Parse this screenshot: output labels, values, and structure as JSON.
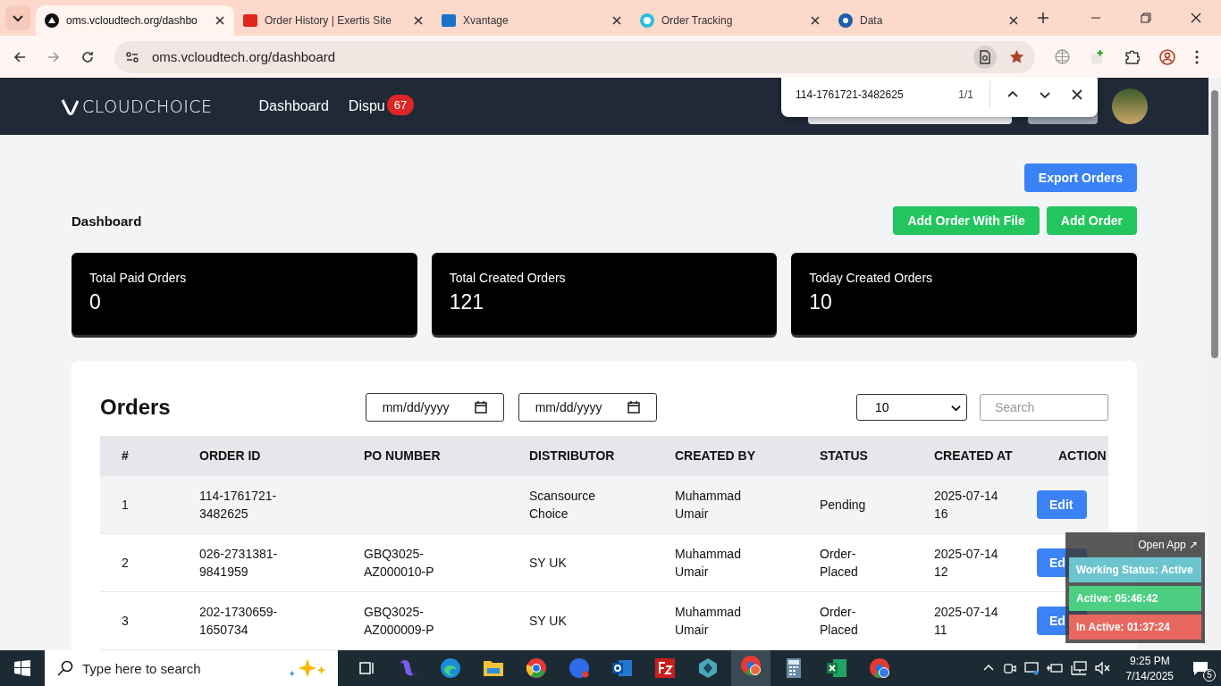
{
  "browser": {
    "tabs": [
      {
        "title": "oms.vcloudtech.org/dashbo",
        "selected": true
      },
      {
        "title": "Order History | Exertis Site",
        "selected": false
      },
      {
        "title": "Xvantage",
        "selected": false
      },
      {
        "title": "Order Tracking",
        "selected": false
      },
      {
        "title": "Data",
        "selected": false
      }
    ],
    "address": "oms.vcloudtech.org/dashboard",
    "find_bar": {
      "query": "114-1761721-3482625",
      "count": "1/1"
    }
  },
  "app": {
    "logo": "CLOUDCHOICE",
    "nav": [
      {
        "label": "Dashboard"
      },
      {
        "label": "Dispu",
        "badge": "67"
      }
    ]
  },
  "toolbar": {
    "export": "Export Orders",
    "heading": "Dashboard",
    "actions": [
      "Add Order With File",
      "Add Order"
    ]
  },
  "stats": [
    {
      "label": "Total Paid Orders",
      "value": "0"
    },
    {
      "label": "Total Created Orders",
      "value": "121"
    },
    {
      "label": "Today Created Orders",
      "value": "10"
    }
  ],
  "orders": {
    "title": "Orders",
    "date_from": {
      "placeholder": "mm/dd/yyyy"
    },
    "date_to": {
      "placeholder": "mm/dd/yyyy"
    },
    "page_size": "10",
    "search": {
      "placeholder": "Search"
    },
    "columns": [
      "#",
      "ORDER ID",
      "PO NUMBER",
      "DISTRIBUTOR",
      "CREATED BY",
      "STATUS",
      "CREATED AT",
      "ACTION"
    ],
    "rows": [
      {
        "n": "1",
        "order_id": "114-1761721-3482625",
        "distributor": "Scansource Choice",
        "created_by": "Muhammad Umair",
        "status": "Pending",
        "created_at": "2025-07-14 16",
        "action": "Edit"
      },
      {
        "n": "2",
        "order_id": "026-2731381-9841959",
        "po": "GBQ3025-AZ000010-P",
        "distributor": "SY UK",
        "created_by": "Muhammad Umair",
        "status": "Order-Placed",
        "created_at": "2025-07-14 12",
        "action": "Ed"
      },
      {
        "n": "3",
        "order_id": "202-1730659-1650734",
        "po": "GBQ3025-AZ000009-P",
        "distributor": "SY UK",
        "created_by": "Muhammad Umair",
        "status": "Order-Placed",
        "created_at": "2025-07-14 11",
        "action": "Ed"
      }
    ]
  },
  "widget": {
    "open_app": "Open App ↗",
    "statuses": [
      {
        "text": "Working Status: Active",
        "color": "#6cc4cf"
      },
      {
        "text": "Active: 05:46:42",
        "color": "#4ccf82"
      },
      {
        "text": "In Active: 01:37:24",
        "color": "#e8675e"
      }
    ]
  },
  "taskbar": {
    "search": {
      "placeholder": "Type here to search"
    },
    "time": "9:25 PM",
    "date": "7/14/2025",
    "notifications": "5"
  }
}
